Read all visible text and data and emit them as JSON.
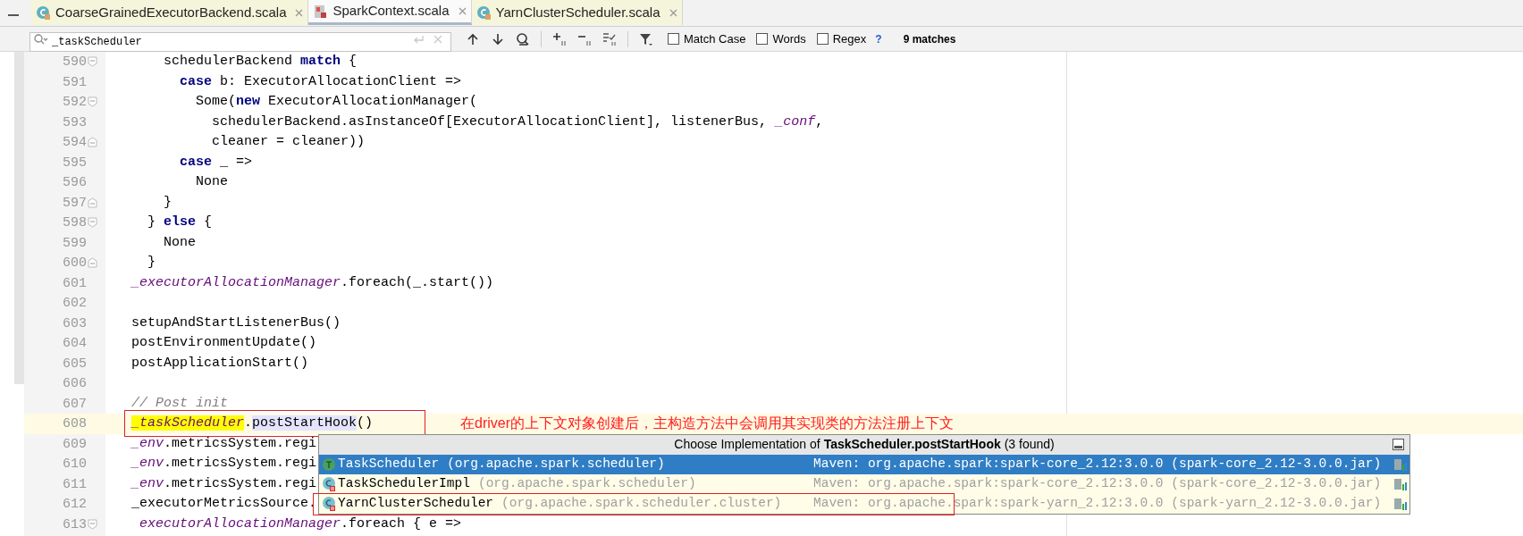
{
  "tabs": [
    {
      "label": "CoarseGrainedExecutorBackend.scala",
      "kind": "class",
      "selected": false
    },
    {
      "label": "SparkContext.scala",
      "kind": "object",
      "selected": true
    },
    {
      "label": "YarnClusterScheduler.scala",
      "kind": "class",
      "selected": false
    }
  ],
  "search": {
    "value": "_taskScheduler",
    "options": [
      {
        "label": "Match Case",
        "checked": false
      },
      {
        "label": "Words",
        "checked": false
      },
      {
        "label": "Regex",
        "checked": false
      }
    ],
    "help": "?",
    "matches": "9 matches"
  },
  "lines": [
    {
      "number": "590",
      "fold_start": true,
      "fold_end": false,
      "current": false,
      "tokens": [
        {
          "kind": "plain",
          "text": "    schedulerBackend "
        },
        {
          "kind": "keyword",
          "text": "match"
        },
        {
          "kind": "plain",
          "text": " {"
        }
      ]
    },
    {
      "number": "591",
      "fold_start": false,
      "fold_end": false,
      "current": false,
      "tokens": [
        {
          "kind": "keyword",
          "text": "      case"
        },
        {
          "kind": "plain",
          "text": " b: ExecutorAllocationClient =>"
        }
      ]
    },
    {
      "number": "592",
      "fold_start": true,
      "fold_end": false,
      "current": false,
      "tokens": [
        {
          "kind": "plain",
          "text": "        Some("
        },
        {
          "kind": "keyword",
          "text": "new"
        },
        {
          "kind": "plain",
          "text": " ExecutorAllocationManager("
        }
      ]
    },
    {
      "number": "593",
      "fold_start": false,
      "fold_end": false,
      "current": false,
      "tokens": [
        {
          "kind": "plain",
          "text": "          schedulerBackend.asInstanceOf[ExecutorAllocationClient], listenerBus, "
        },
        {
          "kind": "field",
          "text": "_conf"
        },
        {
          "kind": "plain",
          "text": ","
        }
      ]
    },
    {
      "number": "594",
      "fold_start": false,
      "fold_end": true,
      "current": false,
      "tokens": [
        {
          "kind": "plain",
          "text": "          cleaner = cleaner))"
        }
      ]
    },
    {
      "number": "595",
      "fold_start": false,
      "fold_end": false,
      "current": false,
      "tokens": [
        {
          "kind": "keyword",
          "text": "      case"
        },
        {
          "kind": "plain",
          "text": " _ =>"
        }
      ]
    },
    {
      "number": "596",
      "fold_start": false,
      "fold_end": false,
      "current": false,
      "tokens": [
        {
          "kind": "plain",
          "text": "        None"
        }
      ]
    },
    {
      "number": "597",
      "fold_start": false,
      "fold_end": true,
      "current": false,
      "tokens": [
        {
          "kind": "plain",
          "text": "    }"
        }
      ]
    },
    {
      "number": "598",
      "fold_start": true,
      "fold_end": false,
      "current": false,
      "tokens": [
        {
          "kind": "plain",
          "text": "  } "
        },
        {
          "kind": "keyword",
          "text": "else"
        },
        {
          "kind": "plain",
          "text": " {"
        }
      ]
    },
    {
      "number": "599",
      "fold_start": false,
      "fold_end": false,
      "current": false,
      "tokens": [
        {
          "kind": "plain",
          "text": "    None"
        }
      ]
    },
    {
      "number": "600",
      "fold_start": false,
      "fold_end": true,
      "current": false,
      "tokens": [
        {
          "kind": "plain",
          "text": "  }"
        }
      ]
    },
    {
      "number": "601",
      "fold_start": false,
      "fold_end": false,
      "current": false,
      "tokens": [
        {
          "kind": "field",
          "text": "_executorAllocationManager"
        },
        {
          "kind": "plain",
          "text": ".foreach(_.start())"
        }
      ]
    },
    {
      "number": "602",
      "fold_start": false,
      "fold_end": false,
      "current": false
    },
    {
      "number": "603",
      "fold_start": false,
      "fold_end": false,
      "current": false,
      "tokens": [
        {
          "kind": "plain",
          "text": "setupAndStartListenerBus()"
        }
      ]
    },
    {
      "number": "604",
      "fold_start": false,
      "fold_end": false,
      "current": false,
      "tokens": [
        {
          "kind": "plain",
          "text": "postEnvironmentUpdate()"
        }
      ]
    },
    {
      "number": "605",
      "fold_start": false,
      "fold_end": false,
      "current": false,
      "tokens": [
        {
          "kind": "plain",
          "text": "postApplicationStart()"
        }
      ]
    },
    {
      "number": "606",
      "fold_start": false,
      "fold_end": false,
      "current": false
    },
    {
      "number": "607",
      "fold_start": false,
      "fold_end": false,
      "current": false,
      "tokens": [
        {
          "kind": "comment",
          "text": "// Post init"
        }
      ]
    },
    {
      "number": "608",
      "fold_start": false,
      "fold_end": false,
      "current": true,
      "tokens": [
        {
          "kind": "match",
          "text": "_taskScheduler"
        },
        {
          "kind": "plain",
          "text": "."
        },
        {
          "kind": "usage",
          "text": "postStartHook"
        },
        {
          "kind": "plain",
          "text": "()"
        }
      ]
    },
    {
      "number": "609",
      "fold_start": false,
      "fold_end": false,
      "current": false,
      "tokens": [
        {
          "kind": "field",
          "text": "_env"
        },
        {
          "kind": "plain",
          "text": ".metricsSystem.regi"
        }
      ]
    },
    {
      "number": "610",
      "fold_start": false,
      "fold_end": false,
      "current": false,
      "tokens": [
        {
          "kind": "field",
          "text": "_env"
        },
        {
          "kind": "plain",
          "text": ".metricsSystem.regi"
        }
      ]
    },
    {
      "number": "611",
      "fold_start": false,
      "fold_end": false,
      "current": false,
      "tokens": [
        {
          "kind": "field",
          "text": "_env"
        },
        {
          "kind": "plain",
          "text": ".metricsSystem.regi"
        }
      ]
    },
    {
      "number": "612",
      "fold_start": false,
      "fold_end": false,
      "current": false,
      "tokens": [
        {
          "kind": "plain",
          "text": "_executorMetricsSource."
        }
      ]
    },
    {
      "number": "613",
      "fold_start": true,
      "fold_end": false,
      "current": false,
      "tokens": [
        {
          "kind": "field",
          "text": " executorAllocationManager"
        },
        {
          "kind": "plain",
          "text": ".foreach { e =>"
        }
      ]
    }
  ],
  "annotation": "在driver的上下文对象创建后，主构造方法中会调用其实现类的方法注册上下文",
  "popup": {
    "title": "Choose Implementation of **TaskScheduler.postStartHook** (3 found)",
    "rows": [
      {
        "kind": "trait",
        "name": "TaskScheduler",
        "package": "(org.apache.spark.scheduler)",
        "library": "Maven: org.apache.spark:spark-core_2.12:3.0.0 (spark-core_2.12-3.0.0.jar)",
        "selected": true
      },
      {
        "kind": "class",
        "name": "TaskSchedulerImpl",
        "package": "(org.apache.spark.scheduler)",
        "library": "Maven: org.apache.spark:spark-core_2.12:3.0.0 (spark-core_2.12-3.0.0.jar)",
        "selected": false
      },
      {
        "kind": "class",
        "name": "YarnClusterScheduler",
        "package": "(org.apache.spark.scheduler.cluster)",
        "library": "Maven: org.apache.spark:spark-yarn_2.12:3.0.0 (spark-yarn_2.12-3.0.0.jar)",
        "selected": false
      }
    ]
  }
}
